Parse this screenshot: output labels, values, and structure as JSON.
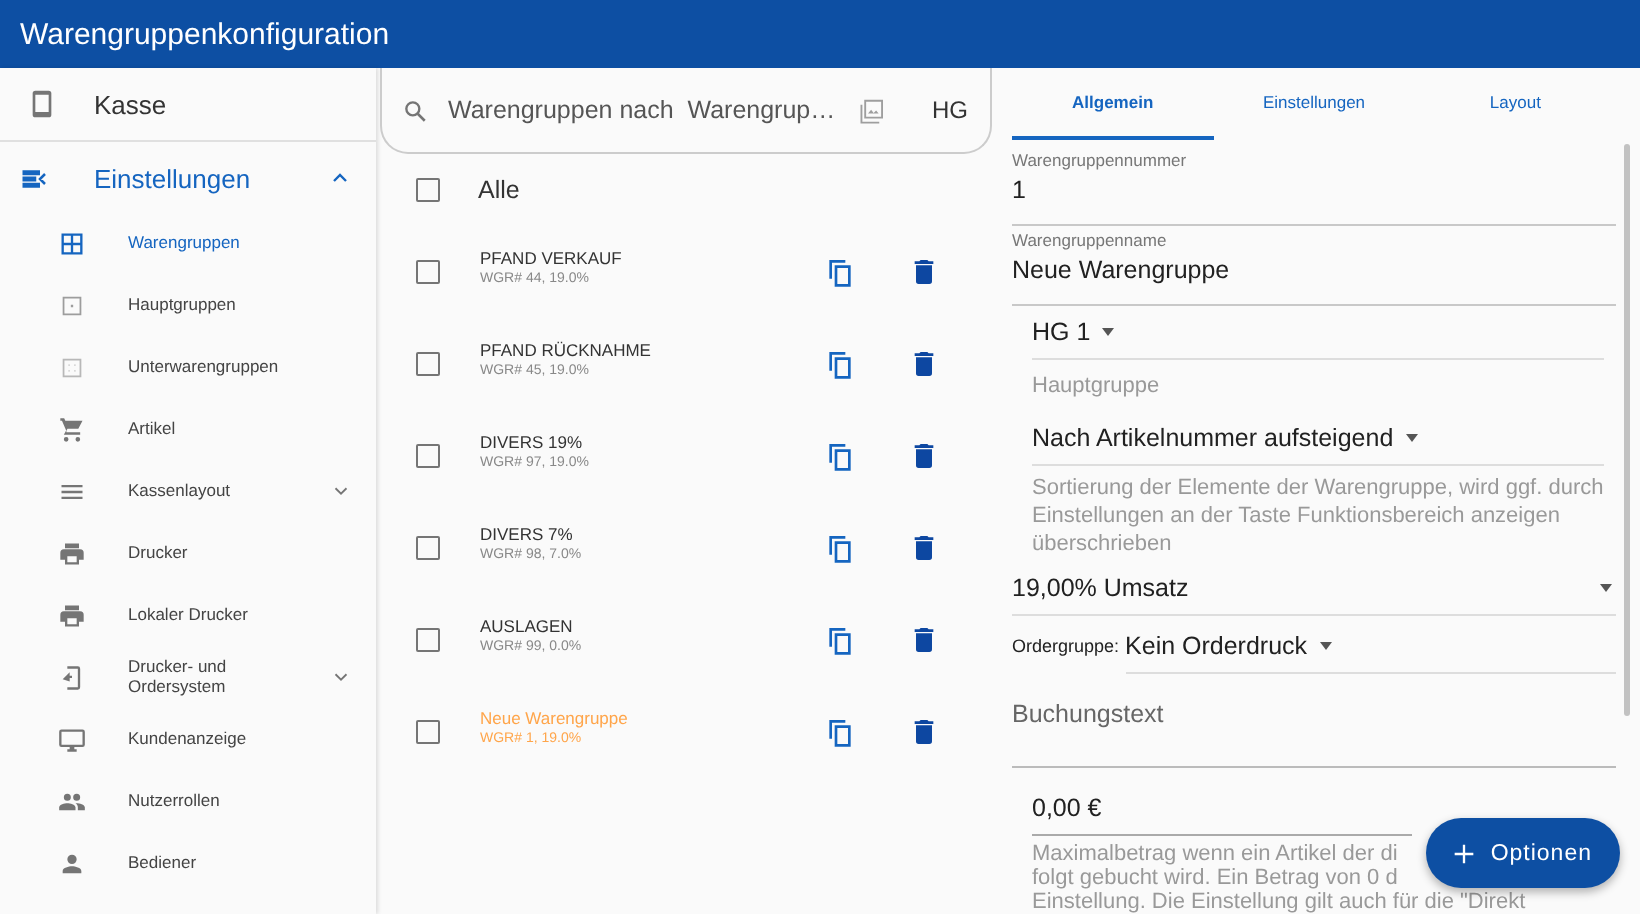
{
  "window": {
    "title": "Warengruppenkonfiguration"
  },
  "sidebar": {
    "top_item": {
      "label": "Kasse"
    },
    "section": {
      "label": "Einstellungen",
      "expanded": true
    },
    "items": [
      {
        "label": "Warengruppen",
        "selected": true
      },
      {
        "label": "Hauptgruppen",
        "selected": false
      },
      {
        "label": "Unterwarengruppen",
        "selected": false
      },
      {
        "label": "Artikel",
        "selected": false
      },
      {
        "label": "Kassenlayout",
        "selected": false,
        "expandable": true
      },
      {
        "label": "Drucker",
        "selected": false
      },
      {
        "label": "Lokaler Drucker",
        "selected": false
      },
      {
        "label": "Drucker- und Ordersystem",
        "selected": false,
        "expandable": true
      },
      {
        "label": "Kundenanzeige",
        "selected": false
      },
      {
        "label": "Nutzerrollen",
        "selected": false
      },
      {
        "label": "Bediener",
        "selected": false
      }
    ]
  },
  "list": {
    "search": {
      "placeholder": "Warengruppen nach  Warengrup…"
    },
    "filter_label": "HG",
    "select_all": {
      "label": "Alle",
      "checked": false
    },
    "rows": [
      {
        "name": "PFAND VERKAUF",
        "detail": "WGR# 44, 19.0%",
        "checked": false,
        "highlighted": false
      },
      {
        "name": "PFAND RÜCKNAHME",
        "detail": "WGR# 45, 19.0%",
        "checked": false,
        "highlighted": false
      },
      {
        "name": "DIVERS 19%",
        "detail": "WGR# 97, 19.0%",
        "checked": false,
        "highlighted": false
      },
      {
        "name": "DIVERS 7%",
        "detail": "WGR# 98, 7.0%",
        "checked": false,
        "highlighted": false
      },
      {
        "name": "AUSLAGEN",
        "detail": "WGR# 99, 0.0%",
        "checked": false,
        "highlighted": false
      },
      {
        "name": "Neue Warengruppe",
        "detail": "WGR# 1, 19.0%",
        "checked": false,
        "highlighted": true
      }
    ]
  },
  "form": {
    "tabs": [
      {
        "label": "Allgemein",
        "selected": true
      },
      {
        "label": "Einstellungen",
        "selected": false
      },
      {
        "label": "Layout",
        "selected": false
      }
    ],
    "number": {
      "label": "Warengruppennummer",
      "value": "1"
    },
    "name": {
      "label": "Warengruppenname",
      "value": "Neue Warengruppe"
    },
    "main_group": {
      "value": "HG 1",
      "hint": "Hauptgruppe"
    },
    "sorting": {
      "value": "Nach Artikelnummer aufsteigend",
      "hint": "Sortierung der Elemente der Warengruppe, wird ggf. durch Einstellungen an der Taste Funktionsbereich anzeigen überschrieben"
    },
    "tax": {
      "value": "19,00% Umsatz"
    },
    "order_group": {
      "label": "Ordergruppe:",
      "value": "Kein Orderdruck"
    },
    "booking_text": {
      "placeholder": "Buchungstext"
    },
    "max_amount": {
      "value": "0,00 €",
      "hint_lines": [
        "Maximalbetrag wenn ein Artikel der di",
        "folgt gebucht wird. Ein Betrag von 0 d",
        "Einstellung. Die Einstellung gilt auch für die \"Direkt"
      ]
    }
  },
  "fab": {
    "label": "Optionen"
  }
}
